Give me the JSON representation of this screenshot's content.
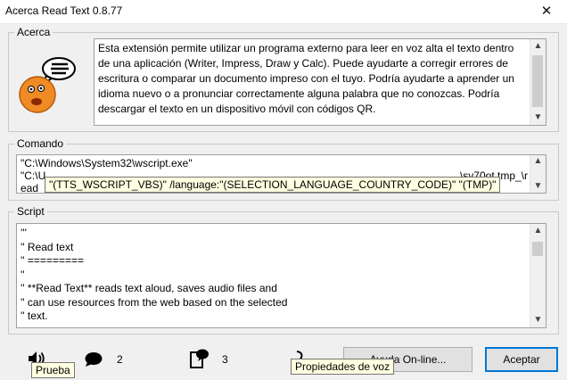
{
  "window": {
    "title": "Acerca Read Text 0.8.77",
    "close_symbol": "✕"
  },
  "about": {
    "legend": "Acerca",
    "text": "Esta extensión permite utilizar un programa externo para leer en voz alta el texto dentro de una aplicación (Writer, Impress, Draw y Calc). Puede ayudarte a corregir errores de escritura o comparar un documento impreso con el tuyo. Podría ayudarte a aprender un idioma nuevo o a pronunciar correctamente alguna palabra que no conozcas. Podría descargar el texto en un dispositivo móvil con códigos QR."
  },
  "command": {
    "legend": "Comando",
    "line1": "\"C:\\Windows\\System32\\wscript.exe\"",
    "line2_start": "\"C:\\U",
    "line2_end": "\\sv70ot.tmp_\\r",
    "line3": "ead",
    "tooltip": "\"(TTS_WSCRIPT_VBS)\" /language:\"(SELECTION_LANGUAGE_COUNTRY_CODE)\" \"(TMP)\""
  },
  "script": {
    "legend": "Script",
    "lines": [
      "'''",
      "'' Read text",
      "'' =========",
      "''",
      "'' **Read Text** reads text aloud, saves audio files and",
      "'' can use resources from the web based on the selected",
      "'' text."
    ]
  },
  "footer": {
    "speaker_tooltip": "Prueba",
    "bubble_count": "2",
    "doc_count": "3",
    "voice_tooltip": "Propiedades de voz",
    "online_button": "Ayuda On-line...",
    "ok_button": "Aceptar"
  },
  "colors": {
    "accent": "#0078d7",
    "tooltip_bg": "#ffffe1",
    "face": "#f08a24"
  }
}
